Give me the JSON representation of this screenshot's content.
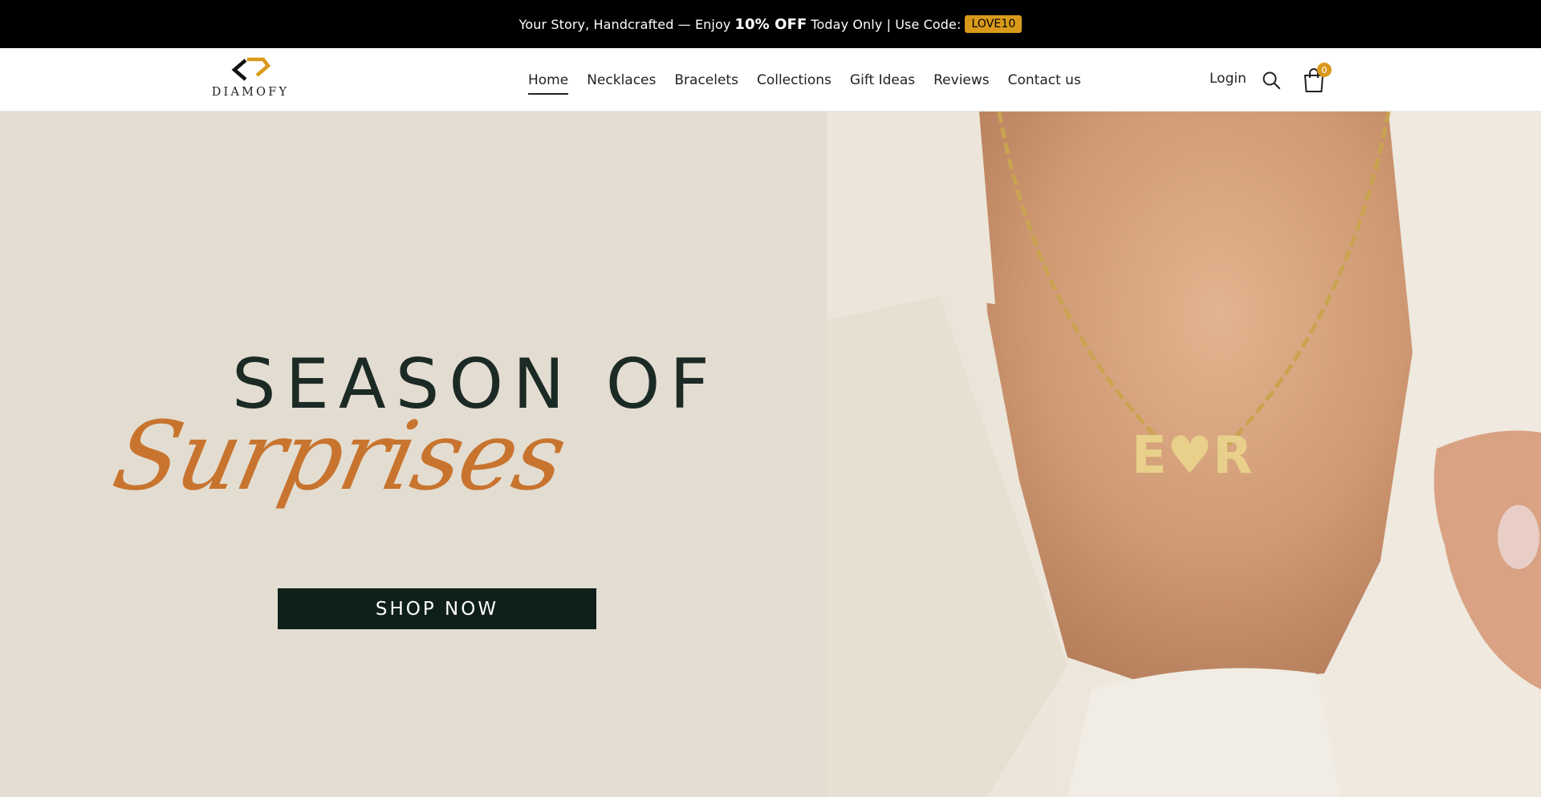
{
  "announcement": {
    "pre": "Your Story, Handcrafted — Enjoy",
    "highlight": "10% OFF",
    "post": "Today Only | Use Code:",
    "code": "LOVE10"
  },
  "logo": {
    "text": "DIAMOFY"
  },
  "nav": {
    "items": [
      "Home",
      "Necklaces",
      "Bracelets",
      "Collections",
      "Gift Ideas",
      "Reviews",
      "Contact us"
    ],
    "active": "Home"
  },
  "header_actions": {
    "login": "Login",
    "cart_count": "0",
    "search_icon": "search-icon",
    "cart_icon": "shopping-bag-icon"
  },
  "hero": {
    "headline_top": "SEASON OF",
    "headline_script": "Surprises",
    "cta": "SHOP NOW",
    "pendant_letters": "E♥R"
  },
  "colors": {
    "announcement_bg": "#000000",
    "code_badge": "#d99a1c",
    "hero_bg": "#e3ddd1",
    "script_color": "#c8742f",
    "headline_color": "#1c2a26",
    "cta_bg": "#0f1f1a"
  }
}
